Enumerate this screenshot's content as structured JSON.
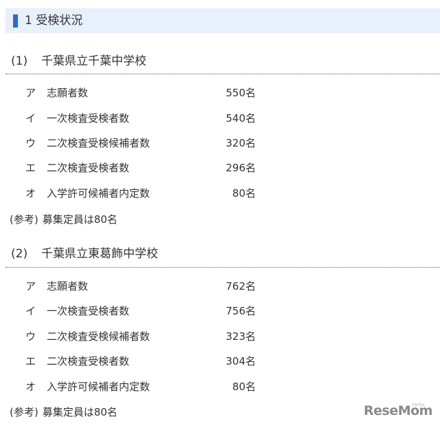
{
  "header": {
    "title": "1 受検状況"
  },
  "sections": [
    {
      "number": "(1)",
      "title": "千葉県立千葉中学校",
      "rows": [
        {
          "letter": "ア",
          "label": "志願者数",
          "value": "550名"
        },
        {
          "letter": "イ",
          "label": "一次検査受検者数",
          "value": "540名"
        },
        {
          "letter": "ウ",
          "label": "二次検査受検候補者数",
          "value": "320名"
        },
        {
          "letter": "エ",
          "label": "二次検査受検者数",
          "value": "296名"
        },
        {
          "letter": "オ",
          "label": "入学許可候補者内定数",
          "value": "80名"
        }
      ],
      "note": {
        "prefix": "(参考)",
        "text": "募集定員は80名"
      }
    },
    {
      "number": "(2)",
      "title": "千葉県立東葛飾中学校",
      "rows": [
        {
          "letter": "ア",
          "label": "志願者数",
          "value": "762名"
        },
        {
          "letter": "イ",
          "label": "一次検査受検者数",
          "value": "756名"
        },
        {
          "letter": "ウ",
          "label": "二次検査受検候補者数",
          "value": "323名"
        },
        {
          "letter": "エ",
          "label": "二次検査受検者数",
          "value": "304名"
        },
        {
          "letter": "オ",
          "label": "入学許可候補者内定数",
          "value": "80名"
        }
      ],
      "note": {
        "prefix": "(参考)",
        "text": "募集定員は80名"
      }
    }
  ],
  "watermark": {
    "logo": "ReseMom",
    "sub": "リセマム"
  }
}
